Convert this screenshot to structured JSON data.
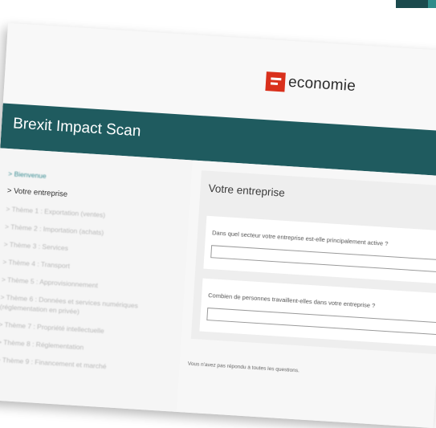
{
  "brand": {
    "logo_text": "economie",
    "colors": {
      "banner": "#1f5b5f",
      "logo_red": "#d9301c",
      "link": "#3f8f95"
    }
  },
  "header": {
    "title": "Brexit Impact Scan"
  },
  "sidebar": {
    "items": [
      {
        "label": "> Bienvenue"
      },
      {
        "label": "> Votre entreprise"
      },
      {
        "label": "> Thème 1 : Exportation (ventes)"
      },
      {
        "label": "> Thème 2 : Importation (achats)"
      },
      {
        "label": "> Thème 3 : Services"
      },
      {
        "label": "> Thème 4 : Transport"
      },
      {
        "label": "> Thème 5 : Approvisionnement"
      },
      {
        "label": "> Thème 6 : Données et services numériques (réglementation en privée)"
      },
      {
        "label": "> Thème 7 : Propriété intellectuelle"
      },
      {
        "label": "> Thème 8 : Réglementation"
      },
      {
        "label": "> Thème 9 : Financement et marché"
      }
    ]
  },
  "main": {
    "section_title": "Votre entreprise",
    "questions": [
      {
        "label": "Dans quel secteur votre entreprise est-elle principalement active ?",
        "value": ""
      },
      {
        "label": "Combien de personnes travaillent-elles dans votre entreprise ?",
        "value": ""
      }
    ],
    "footnote": "Vous n'avez pas répondu à toutes les questions."
  },
  "icons": {
    "logo": "economie-logo-icon"
  }
}
